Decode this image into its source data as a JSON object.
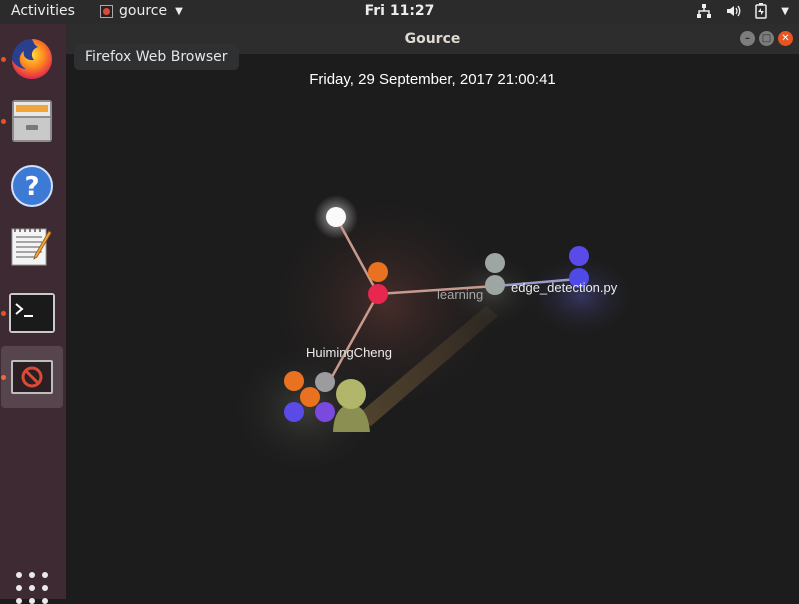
{
  "topbar": {
    "activities": "Activities",
    "app_name": "gource",
    "clock": "Fri 11:27"
  },
  "dock": {
    "items": [
      {
        "name": "firefox",
        "icon": "firefox-icon",
        "running": true,
        "active": false
      },
      {
        "name": "files",
        "icon": "file-cabinet-icon",
        "running": true,
        "active": false
      },
      {
        "name": "help",
        "icon": "help-icon",
        "running": false,
        "active": false
      },
      {
        "name": "text-editor",
        "icon": "notepad-icon",
        "running": false,
        "active": false
      },
      {
        "name": "terminal",
        "icon": "terminal-icon",
        "running": true,
        "active": false
      },
      {
        "name": "gource",
        "icon": "gource-icon",
        "running": true,
        "active": true
      }
    ]
  },
  "tooltip": {
    "text": "Firefox Web Browser"
  },
  "window": {
    "title": "Gource",
    "visualization": {
      "date": "Friday, 29 September, 2017 21:00:41",
      "user": "HuimingCheng",
      "directory": "learning",
      "file": "edge_detection.py"
    }
  },
  "colors": {
    "accent": "#e95420",
    "dock_bg": "#3d2a33",
    "topbar_bg": "#2b2b2b"
  }
}
